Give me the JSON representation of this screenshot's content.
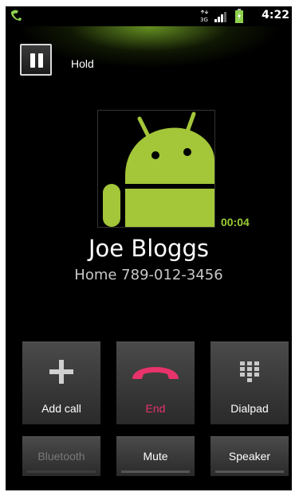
{
  "status_bar": {
    "time": "4:22",
    "network": "3G"
  },
  "hold": {
    "label": "Hold"
  },
  "call": {
    "timer": "00:04",
    "name": "Joe Bloggs",
    "number": "Home 789-012-3456"
  },
  "actions": {
    "add_call": "Add call",
    "end": "End",
    "dialpad": "Dialpad",
    "bluetooth": "Bluetooth",
    "mute": "Mute",
    "speaker": "Speaker"
  },
  "colors": {
    "end_red": "#e8336a",
    "timer_green": "#99cc33",
    "android_green": "#a4c639"
  }
}
